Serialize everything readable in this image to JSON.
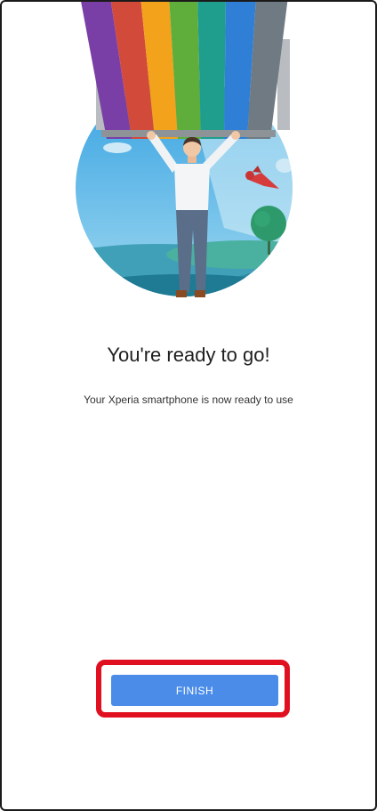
{
  "screen": {
    "title": "You're ready to go!",
    "subtitle": "Your Xperia smartphone is now ready to use"
  },
  "actions": {
    "finish_label": "FINISH"
  },
  "illustration": {
    "icon": "person-holding-rainbow-banner-illustration",
    "stripe_colors": [
      "#7a3fa6",
      "#d24a3a",
      "#f2a21b",
      "#5fae3b",
      "#1f9e8e",
      "#2f7fd6",
      "#6f7a82"
    ],
    "sky_color": "#5eb3e6",
    "ground_color": "#3a8fa8"
  },
  "colors": {
    "accent": "#4a8ce8",
    "highlight": "#e01020"
  }
}
